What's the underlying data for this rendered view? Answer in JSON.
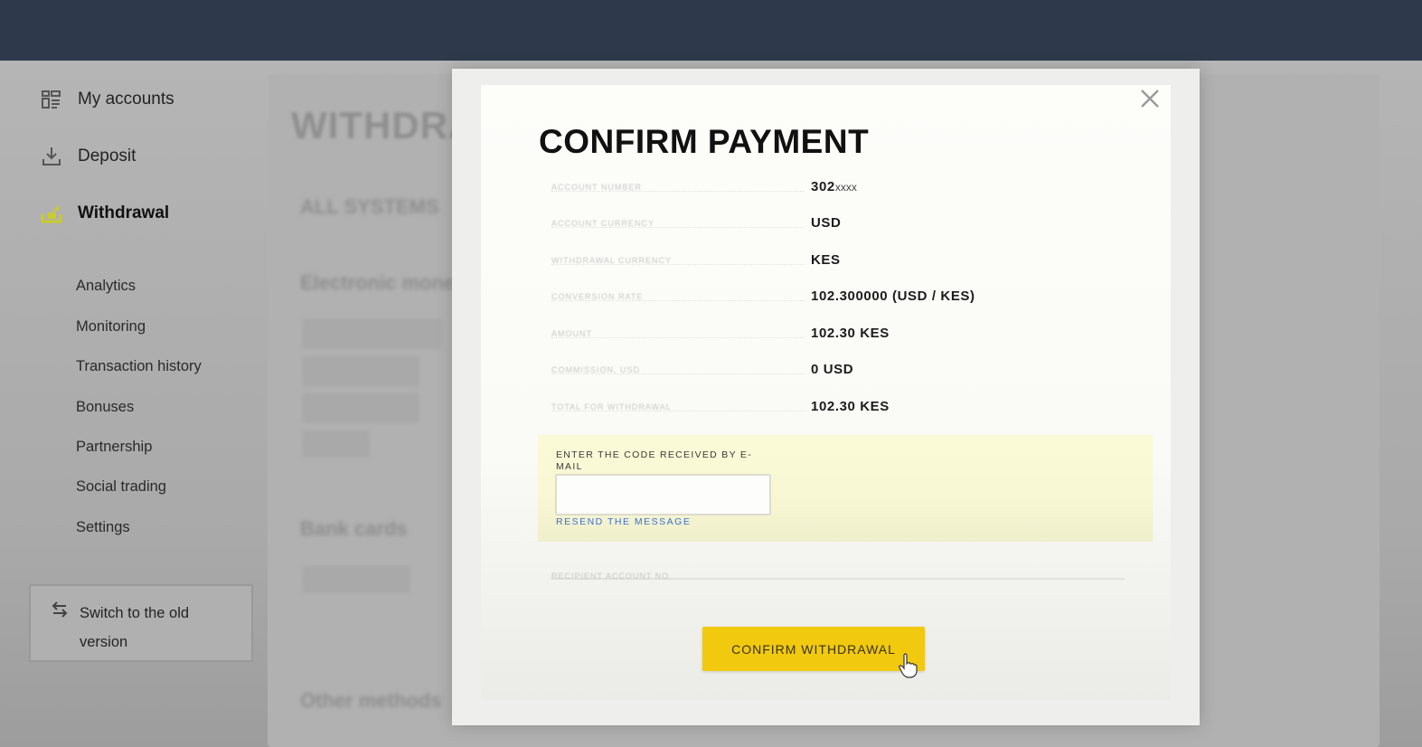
{
  "sidebar": {
    "main_items": [
      {
        "label": "My accounts",
        "icon": "dashboard-grid-icon",
        "active": false
      },
      {
        "label": "Deposit",
        "icon": "download-tray-icon",
        "active": false
      },
      {
        "label": "Withdrawal",
        "icon": "withdraw-tray-icon",
        "active": true
      }
    ],
    "sub_items": [
      {
        "label": "Analytics"
      },
      {
        "label": "Monitoring"
      },
      {
        "label": "Transaction history"
      },
      {
        "label": "Bonuses"
      },
      {
        "label": "Partnership"
      },
      {
        "label": "Social trading"
      },
      {
        "label": "Settings"
      }
    ],
    "switch_version": {
      "label": "Switch to the old version",
      "icon": "swap-arrows-icon"
    }
  },
  "background_page": {
    "title": "WITHDRAWAL",
    "filter_label": "ALL SYSTEMS",
    "sections": [
      "Electronic money",
      "Bank cards",
      "Other methods"
    ]
  },
  "modal": {
    "title": "CONFIRM PAYMENT",
    "close_icon": "close-x-icon",
    "details": [
      {
        "label": "Account number",
        "value": "302",
        "masked_suffix": "xxxx"
      },
      {
        "label": "Account currency",
        "value": "USD"
      },
      {
        "label": "Withdrawal currency",
        "value": "KES"
      },
      {
        "label": "Conversion rate",
        "value": "102.300000 (USD / KES)"
      },
      {
        "label": "Amount",
        "value": "102.30 KES"
      },
      {
        "label": "Commission, USD",
        "value": "0 USD"
      },
      {
        "label": "Total for withdrawal",
        "value": "102.30 KES"
      }
    ],
    "code_section": {
      "label": "ENTER THE CODE RECEIVED BY E-MAIL",
      "input_value": "",
      "input_placeholder": "",
      "resend_link": "RESEND THE MESSAGE"
    },
    "recipient_label": "Recipient account no.",
    "confirm_button": "CONFIRM WITHDRAWAL"
  },
  "colors": {
    "header": "#2e3a4b",
    "accent_yellow": "#f1c90f",
    "code_panel": "#f8f8d5",
    "link_blue": "#3d6fd1"
  }
}
